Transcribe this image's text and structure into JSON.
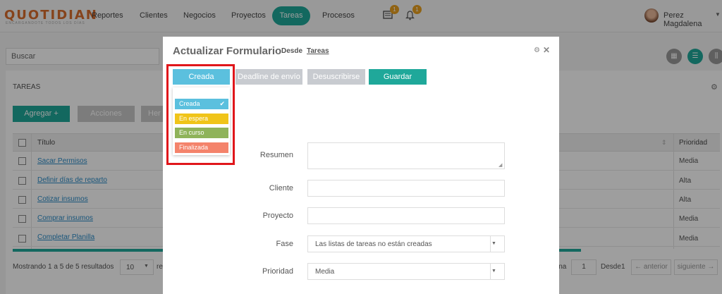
{
  "nav": {
    "logo": "QUOTIDIAN",
    "logo_sub": "ENCARGANDOTE TODOS LOS DÍAS",
    "items": [
      "Reportes",
      "Clientes",
      "Negocios",
      "Proyectos",
      "Tareas",
      "Procesos"
    ],
    "active": "Tareas",
    "messages_badge": "1",
    "notifications_badge": "1",
    "user_name": "Perez Magdalena"
  },
  "search": {
    "placeholder": "Buscar"
  },
  "tasks": {
    "title": "TAREAS",
    "add_button": "Agregar +",
    "actions_button": "Acciones",
    "tools_button": "Her",
    "columns": {
      "title": "Título",
      "priority": "Prioridad"
    },
    "rows": [
      {
        "title": "Sacar Permisos",
        "priority": "Media"
      },
      {
        "title": "Definir días de reparto",
        "priority": "Alta"
      },
      {
        "title": "Cotizar insumos",
        "priority": "Alta"
      },
      {
        "title": "Comprar insumos",
        "priority": "Media"
      },
      {
        "title": "Completar Planilla",
        "priority": "Media"
      }
    ],
    "footer": {
      "showing": "Mostrando 1 a 5 de 5 resultados",
      "per_page": "10",
      "per_page_suffix": "re",
      "page_label": "ina",
      "page_value": "1",
      "of_label": "Desde",
      "of_value": "1",
      "prev": "← anterior",
      "next": "siguiente →"
    }
  },
  "modal": {
    "title": "Actualizar Formulario",
    "from_label": "Desde",
    "from_link": "Tareas",
    "buttons": {
      "status": "Creada",
      "deadline": "Deadline de envío",
      "unsubscribe": "Desuscribirse",
      "save": "Guardar"
    },
    "status_options": [
      {
        "label": "Creada",
        "color": "#5bc0de",
        "selected": true
      },
      {
        "label": "En espera",
        "color": "#f0c419",
        "selected": false
      },
      {
        "label": "En curso",
        "color": "#8fb35a",
        "selected": false
      },
      {
        "label": "Finalizada",
        "color": "#f4836b",
        "selected": false
      }
    ],
    "fields": {
      "summary_label": "Resumen",
      "summary_value": "",
      "client_label": "Cliente",
      "client_value": "",
      "project_label": "Proyecto",
      "project_value": "",
      "phase_label": "Fase",
      "phase_value": "Las listas de tareas no están creadas",
      "priority_label": "Prioridad",
      "priority_value": "Media"
    }
  },
  "colors": {
    "accent": "#1fa89a",
    "status_button": "#5bc0de",
    "highlight": "#e0161b",
    "logo": "#d96c2c"
  }
}
